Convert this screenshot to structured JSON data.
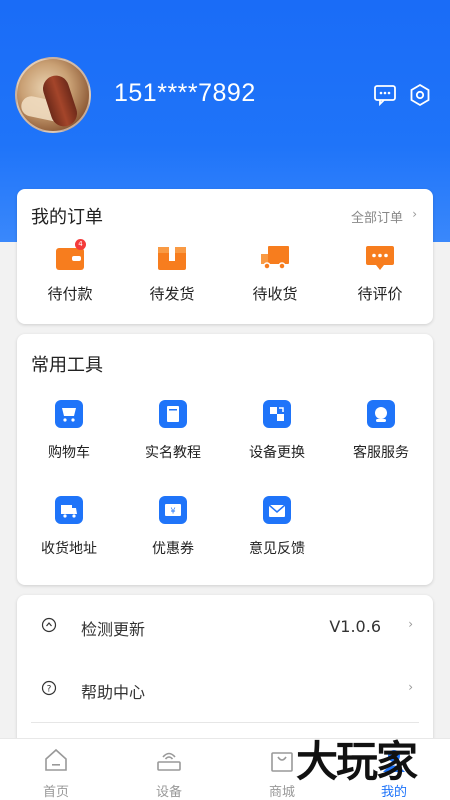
{
  "header": {
    "phone": "151****7892",
    "icons": [
      "message-icon",
      "settings-icon"
    ],
    "gradient_color": "#1f74f9"
  },
  "orders": {
    "title": "我的订单",
    "all_label": "全部订单",
    "items": [
      {
        "label": "待付款",
        "badge": "4",
        "icon": "wallet-icon"
      },
      {
        "label": "待发货",
        "icon": "package-icon"
      },
      {
        "label": "待收货",
        "icon": "truck-icon"
      },
      {
        "label": "待评价",
        "icon": "comment-icon"
      }
    ],
    "accent": "#f77d1e"
  },
  "tools": {
    "title": "常用工具",
    "items": [
      {
        "label": "购物车",
        "icon": "cart-icon"
      },
      {
        "label": "实名教程",
        "icon": "book-icon"
      },
      {
        "label": "设备更换",
        "icon": "swap-icon"
      },
      {
        "label": "客服服务",
        "icon": "headset-icon"
      },
      {
        "label": "收货地址",
        "icon": "delivery-icon"
      },
      {
        "label": "优惠券",
        "icon": "coupon-icon"
      },
      {
        "label": "意见反馈",
        "icon": "feedback-icon"
      }
    ],
    "accent": "#1f74f9"
  },
  "menu": {
    "items": [
      {
        "label": "检测更新",
        "value": "V1.0.6",
        "icon": "update-icon"
      },
      {
        "label": "帮助中心",
        "value": "",
        "icon": "help-icon"
      }
    ]
  },
  "tabbar": {
    "items": [
      {
        "label": "首页",
        "icon": "home-icon"
      },
      {
        "label": "设备",
        "icon": "router-icon"
      },
      {
        "label": "商城",
        "icon": "shop-bag-icon"
      },
      {
        "label": "我的",
        "icon": "profile-icon",
        "active": true
      }
    ]
  },
  "watermark": "大玩家"
}
